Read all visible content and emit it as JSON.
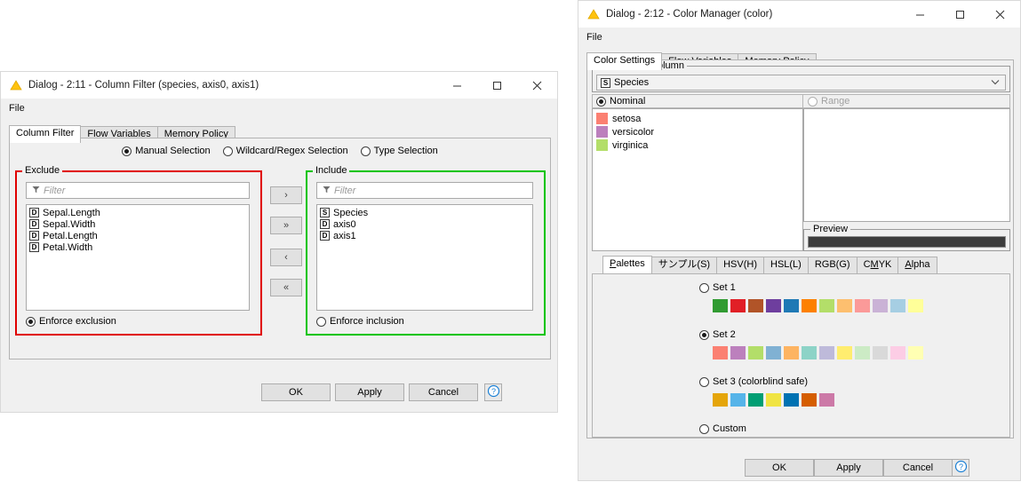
{
  "left_dialog": {
    "title": "Dialog - 2:11 - Column Filter (species, axis0, axis1)",
    "icon": "knime-triangle-icon",
    "menu": {
      "file": "File"
    },
    "window_controls": {
      "minimize": "minimize-icon",
      "maximize": "maximize-icon",
      "close": "close-icon"
    },
    "tabs": [
      {
        "label": "Column Filter",
        "active": true
      },
      {
        "label": "Flow Variables",
        "active": false
      },
      {
        "label": "Memory Policy",
        "active": false
      }
    ],
    "selection_modes": [
      {
        "label": "Manual Selection",
        "selected": true
      },
      {
        "label": "Wildcard/Regex Selection",
        "selected": false
      },
      {
        "label": "Type Selection",
        "selected": false
      }
    ],
    "exclude": {
      "title": "Exclude",
      "frame_color": "#e00000",
      "filter_placeholder": "Filter",
      "items": [
        {
          "type": "D",
          "name": "Sepal.Length"
        },
        {
          "type": "D",
          "name": "Sepal.Width"
        },
        {
          "type": "D",
          "name": "Petal.Length"
        },
        {
          "type": "D",
          "name": "Petal.Width"
        }
      ],
      "enforce": {
        "label": "Enforce exclusion",
        "selected": true
      }
    },
    "include": {
      "title": "Include",
      "frame_color": "#00c400",
      "filter_placeholder": "Filter",
      "items": [
        {
          "type": "S",
          "name": "Species"
        },
        {
          "type": "D",
          "name": "axis0"
        },
        {
          "type": "D",
          "name": "axis1"
        }
      ],
      "enforce": {
        "label": "Enforce inclusion",
        "selected": false
      }
    },
    "transfer_buttons": [
      {
        "label": "›",
        "name": "move-right-button"
      },
      {
        "label": "»",
        "name": "move-all-right-button"
      },
      {
        "label": "‹",
        "name": "move-left-button"
      },
      {
        "label": "«",
        "name": "move-all-left-button"
      }
    ],
    "footer": {
      "ok": "OK",
      "apply": "Apply",
      "cancel": "Cancel",
      "help": "?"
    }
  },
  "right_dialog": {
    "title": "Dialog - 2:12 - Color Manager (color)",
    "icon": "knime-triangle-icon",
    "menu": {
      "file": "File"
    },
    "window_controls": {
      "minimize": "minimize-icon",
      "maximize": "maximize-icon",
      "close": "close-icon"
    },
    "tabs": [
      {
        "label": "Color Settings",
        "active": true
      },
      {
        "label": "Flow Variables",
        "active": false
      },
      {
        "label": "Memory Policy",
        "active": false
      }
    ],
    "select_column": {
      "title": "Select one Column",
      "value": "Species",
      "value_type": "S",
      "caret": "chevron-down-icon"
    },
    "nominal": {
      "label": "Nominal",
      "selected": true,
      "items": [
        {
          "label": "setosa",
          "color": "#fb8072"
        },
        {
          "label": "versicolor",
          "color": "#bc80bd"
        },
        {
          "label": "virginica",
          "color": "#b3de69"
        }
      ]
    },
    "range": {
      "label": "Range",
      "selected": false,
      "preview_title": "Preview",
      "preview_color": "#3c3c3c"
    },
    "color_tabs": [
      {
        "label": "Palettes",
        "mnemonic": "P",
        "active": true
      },
      {
        "label": "サンプル(S)",
        "mnemonic": "S",
        "active": false
      },
      {
        "label": "HSV(H)",
        "mnemonic": "H",
        "active": false
      },
      {
        "label": "HSL(L)",
        "mnemonic": "L",
        "active": false
      },
      {
        "label": "RGB(G)",
        "mnemonic": "G",
        "active": false
      },
      {
        "label": "CMYK",
        "mnemonic": "M",
        "active": false
      },
      {
        "label": "Alpha",
        "mnemonic": "A",
        "active": false
      }
    ],
    "palettes": [
      {
        "label": "Set 1",
        "selected": false,
        "colors": [
          "#319b32",
          "#e11f26",
          "#b15428",
          "#6e3e9e",
          "#1f79b5",
          "#fd8000",
          "#b3de69",
          "#fdbf6f",
          "#fb9a99",
          "#cab2d6",
          "#a6cee3",
          "#ffff99"
        ]
      },
      {
        "label": "Set 2",
        "selected": true,
        "colors": [
          "#fb8072",
          "#bc80bd",
          "#b3de69",
          "#80b1d3",
          "#fdb462",
          "#8dd3c7",
          "#bebada",
          "#ffed6f",
          "#ccebc5",
          "#d9d9d9",
          "#fccde5",
          "#ffffb3"
        ]
      },
      {
        "label": "Set 3 (colorblind safe)",
        "selected": false,
        "colors": [
          "#e5a50a",
          "#56b4e9",
          "#009e73",
          "#f0e442",
          "#0072b2",
          "#d55e00",
          "#cc79a7"
        ]
      },
      {
        "label": "Custom",
        "selected": false,
        "colors": []
      }
    ],
    "footer": {
      "ok": "OK",
      "apply": "Apply",
      "cancel": "Cancel",
      "help": "?"
    }
  }
}
